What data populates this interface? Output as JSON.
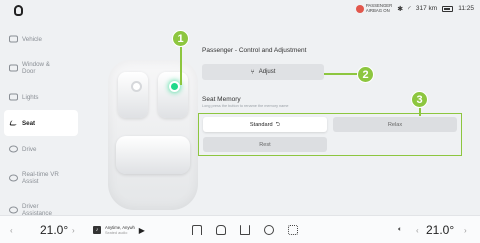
{
  "status": {
    "airbag_line1": "PASSENGER",
    "airbag_line2": "AIRBAG ON",
    "range": "317 km",
    "time": "11:25"
  },
  "sidebar": {
    "items": [
      {
        "label": "Vehicle",
        "icon": "car-icon"
      },
      {
        "label": "Window & Door",
        "icon": "window-icon"
      },
      {
        "label": "Lights",
        "icon": "lights-icon"
      },
      {
        "label": "Seat",
        "icon": "seat-icon",
        "active": true
      },
      {
        "label": "Drive",
        "icon": "steering-icon"
      },
      {
        "label": "Real-time VR Assist",
        "icon": "vr-icon"
      },
      {
        "label": "Driver Assistance",
        "icon": "driver-assist-icon"
      }
    ]
  },
  "callouts": [
    "1",
    "2",
    "3"
  ],
  "panel": {
    "control_title": "Passenger - Control and Adjustment",
    "adjust_label": "Adjust",
    "memory_title": "Seat Memory",
    "memory_hint": "Long press the button to rename the memory name",
    "memory_options": [
      "Standard",
      "Relax",
      "Rest"
    ]
  },
  "bottom": {
    "left_temp": "21.0°",
    "right_temp": "21.0°",
    "music_title": "Anytime, Anywh",
    "music_sub": "Seated audio"
  },
  "colors": {
    "callout": "#8dc63f",
    "seat_highlight": "#1fd98a",
    "airbag": "#e2574c"
  }
}
